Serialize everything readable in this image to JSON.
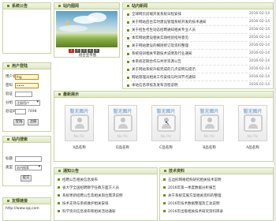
{
  "sidebar": {
    "sys_title": "系统公告",
    "login_title": "用户登陆",
    "login": {
      "username_label": "用户名",
      "username_value": "fng",
      "password_label": "密码",
      "password_value": "••••",
      "code_label": "验证",
      "identity_label": "分组",
      "identity_value": "注册用户",
      "checkcode_label": "验证码",
      "checkcode_value": "7498",
      "login_button": "登陆",
      "register_button": "注册"
    },
    "search_title": "站内搜索",
    "search": {
      "keyword_label": "标题",
      "type_label": "类型",
      "type_value": "站内搜索",
      "submit_button": "提交"
    },
    "links_title": "友情链接",
    "links_url": "http://www.qq.com"
  },
  "slideshow": {
    "title": "站内图闻",
    "pages": [
      "1",
      "2",
      "3",
      "4",
      "5"
    ],
    "active_page": "1",
    "caption": "组合宣传图"
  },
  "news": {
    "title": "站内新闻",
    "items": [
      {
        "title": "全球网页前端开发系统日程安排",
        "date": "2016-02-14"
      },
      {
        "title": "关于网站后台实时建设管理系统开发的技术通知",
        "date": "2016-02-14"
      },
      {
        "title": "关于招生考生动态招聘通知相关专业人员",
        "date": "2016-02-14"
      },
      {
        "title": "本年网站建设相关实践经验指导意见",
        "date": "2016-02-14"
      },
      {
        "title": "关于网站建设的细则修订及资料整理",
        "date": "2016-02-14"
      },
      {
        "title": "系统培训相关专题技术说明及行业通知",
        "date": "2016-02-14"
      },
      {
        "title": "本系统近期合作与共享资源公告",
        "date": "2016-02-14"
      },
      {
        "title": "关于网站系统升级完成的几点说明与提示",
        "date": "2016-02-14"
      },
      {
        "title": "网站管理员相关工作安排与时间节点通知",
        "date": "2016-02-14"
      },
      {
        "title": "本站信息审核及发布流程说明",
        "date": "2016-02-14"
      }
    ]
  },
  "showcase": {
    "title": "最新展示",
    "placeholder_title": "暂无图片",
    "placeholder_text": "No Pic",
    "items": [
      {
        "caption": "X品名称"
      },
      {
        "caption": "D品名称"
      },
      {
        "caption": "C品名称"
      },
      {
        "caption": "B品名称"
      },
      {
        "caption": "A品名称"
      }
    ]
  },
  "notice": {
    "title": "通知公告",
    "items": [
      {
        "title": "招聘公告相关信息发布"
      },
      {
        "title": "省大学全国招聘教学任教方面方人员"
      },
      {
        "title": "系统更新招聘公告及相关岗位需求说明"
      },
      {
        "title": "技术支持与系统维护相关安排"
      },
      {
        "title": "科学资讯信息发布和相关活动通知"
      }
    ]
  },
  "tech": {
    "title": "技术资料",
    "items": [
      {
        "title": "五边形网格结构研究相关技术说明"
      },
      {
        "title": "2016年第一季度数据分析报告"
      },
      {
        "title": "关于系统实施方案相关资料的整理"
      },
      {
        "title": "2016年技术数据整理及汇总说明"
      },
      {
        "title": "2016年出版相关技术研究资料目录"
      }
    ]
  }
}
